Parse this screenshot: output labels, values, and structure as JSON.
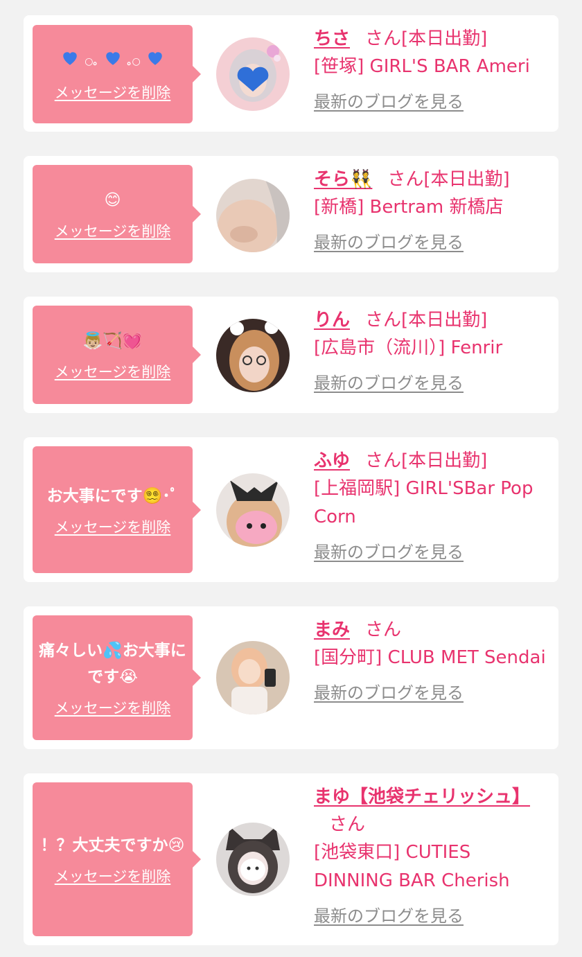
{
  "delete_label": "メッセージを削除",
  "blog_label": "最新のブログを見る",
  "san_label": "さん",
  "colors": {
    "accent": "#e8336e",
    "bubble": "#f68a9a",
    "background": "#f2f2f2"
  },
  "cards": [
    {
      "message": "💙｡.💙.｡💙",
      "name": "ちさ",
      "status": "[本日出勤]",
      "shop": "[笹塚] GIRL'S BAR Ameri"
    },
    {
      "message": "😊",
      "name": "そら👯",
      "status": "[本日出勤]",
      "shop": "[新橋] Bertram 新橋店"
    },
    {
      "message": "👼🏼🏹💓",
      "name": "りん",
      "status": "[本日出勤]",
      "shop": "[広島市（流川）] Fenrir"
    },
    {
      "message": "お大事にです😵‍💫･ﾟ",
      "name": "ふゆ",
      "status": "[本日出勤]",
      "shop": "[上福岡駅] GIRL'SBar Pop Corn"
    },
    {
      "message": "痛々しい💦お大事にです😭",
      "name": "まみ",
      "status": "",
      "shop": "[国分町] CLUB MET Sendai"
    },
    {
      "message": "！？大丈夫ですか😢",
      "name": "まゆ【池袋チェリッシュ】",
      "status": "",
      "shop": "[池袋東口] CUTIES DINNING BAR Cherish"
    }
  ]
}
